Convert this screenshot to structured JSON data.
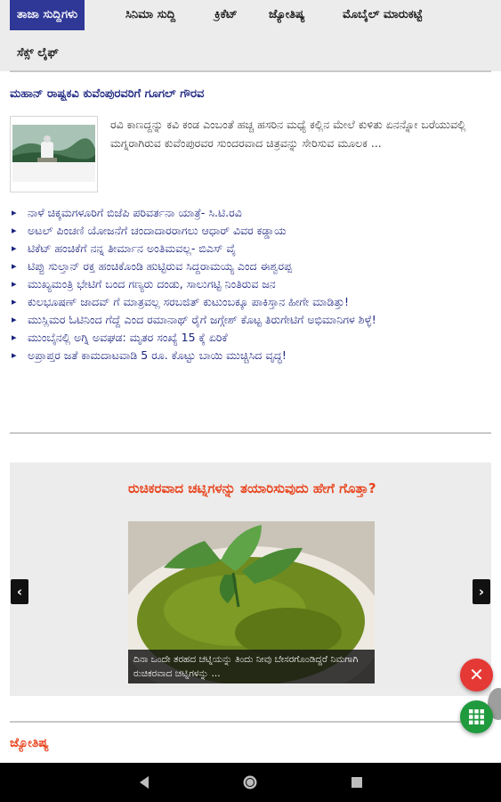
{
  "tabs": [
    {
      "label": "ತಾಜಾ ಸುದ್ದಿಗಳು",
      "active": true
    },
    {
      "label": "ಸಿನಿಮಾ ಸುದ್ದಿ",
      "active": false
    },
    {
      "label": "ಕ್ರಿಕೆಟ್",
      "active": false
    },
    {
      "label": "ಜ್ಯೋತಿಷ್ಯ",
      "active": false
    },
    {
      "label": "ಮೊಬೈಲ್ ಮಾರುಕಟ್ಟೆ",
      "active": false
    },
    {
      "label": "ಸೆಕ್ಸ್ ಲೈಫ್",
      "active": false
    }
  ],
  "headline": {
    "title": "ಮಹಾನ್ ರಾಷ್ಟ್ರಕವಿ ಕುವೆಂಪುರವರಿಗೆ ಗೂಗಲ್ ಗೌರವ",
    "summary": "ರವಿ ಕಾಣದ್ದನ್ನು ಕವಿ ಕಂಡ ಎಂಬಂತೆ ಹಚ್ಚ ಹಸರಿನ ಮಧ್ಯೆ ಕಲ್ಲಿನ ಮೇಲೆ ಕುಳಿತು ಏನನ್ನೋ ಬರೆಯುವಲ್ಲಿ ಮಗ್ನರಾಗಿರುವ ಕುವೆಂಪುರವರ ಸುಂದರವಾದ ಚಿತ್ರವನ್ನು ಸೇರಿಸುವ ಮೂಲಕ ..."
  },
  "news": [
    "ನಾಳೆ ಚಿಕ್ಕಮಗಳೂರಿಗೆ ಬಿಜೆಪಿ ಪರಿವರ್ತನಾ ಯಾತ್ರೆ- ಸಿ.ಟಿ.ರವಿ",
    "ಅಟಲ್ ಪಿಂಚಣಿ ಯೋಜನೆಗೆ ಚಂದಾದಾರರಾಗಲು ಆಧಾರ್ ವಿವರ ಕಡ್ಡಾಯ",
    "ಟಿಕೆಟ್ ಹಂಚಿಕೆಗೆ ನನ್ನ ತೀರ್ಮಾನ ಅಂತಿಮವಲ್ಲ- ಬಿಎಸ್ ವೈ",
    "ಟಿಪ್ಪು ಸುಲ್ತಾನ್ ರಕ್ತ ಹಂಚಿಕೊಂಡಿ ಹುಟ್ಟಿರುವ ಸಿದ್ದರಾಮಯ್ಯ ಎಂದ ಈಶ್ವರಪ್ಪ",
    "ಮುಖ್ಯಮಂತ್ರಿ ಭೇಟಿಗೆ ಬಂದ ಗಣ್ಯರು ದಂಡು, ಸಾಲುಗಟ್ಟಿ ನಿಂತಿರುವ ಜನ",
    "ಕುಲಭೂಷಣ್ ಜಾದವ್ ಗೆ ಮಾತ್ರವಲ್ಲ ಸರಬಜಿತ್ ಕುಟುಂಬಕ್ಕೂ ಪಾಕಿಸ್ತಾನ ಹೀಗೇ ಮಾಡಿತ್ತು!",
    "ಮುಸ್ಲಿಮರ ಓಟಿನಿಂದ ಗೆದ್ದೆ ಎಂದ ರಮಾನಾಥ್ ರೈಗೆ ಜಗ್ಗೇಶ್ ಕೊಟ್ಟ ತಿರುಗೇಟಿಗೆ ಅಭಿಮಾನಿಗಳ ಶಿಳ್ಳೆ!",
    "ಮುಂಬೈನಲ್ಲಿ ಅಗ್ನಿ ಅವಘಡ: ಮೃತರ ಸಂಖ್ಯೆ 15 ಕ್ಕೆ ಏರಿಕೆ",
    "ಅಪ್ರಾಪ್ತರ ಜತೆ ಕಾಮದಾಟವಾಡಿ 5 ರೂ. ಕೊಟ್ಟು ಬಾಯಿ ಮುಚ್ಚಿಸಿದ ವೃದ್ಧ!"
  ],
  "slider": {
    "title": "ರುಚಿಕರವಾದ ಚಟ್ನಿಗಳನ್ನು ತಯಾರಿಸುವುದು ಹೇಗೆ ಗೊತ್ತಾ?",
    "caption": "ದಿನಾ ಒಂದೇ ತರಹದ ಚಟ್ನಿಯನ್ನು ತಿಂದು ನೀವು ಬೇಸರಗೊಂಡಿದ್ದರೆ ನಿಮಗಾಗಿ ರುಚಿಕರವಾದ ಚಟ್ನಿಗಳನ್ನು ...",
    "prev_label": "‹",
    "next_label": "›"
  },
  "fab": {
    "close_label": "✕"
  },
  "section": {
    "heading": "ಜ್ಯೋತಿಷ್ಯ"
  },
  "colors": {
    "tab_active": "#2f3797",
    "link": "#1a237e",
    "accent": "#e8451e",
    "fab_close": "#e53935",
    "fab_grid": "#1f9a3d"
  }
}
